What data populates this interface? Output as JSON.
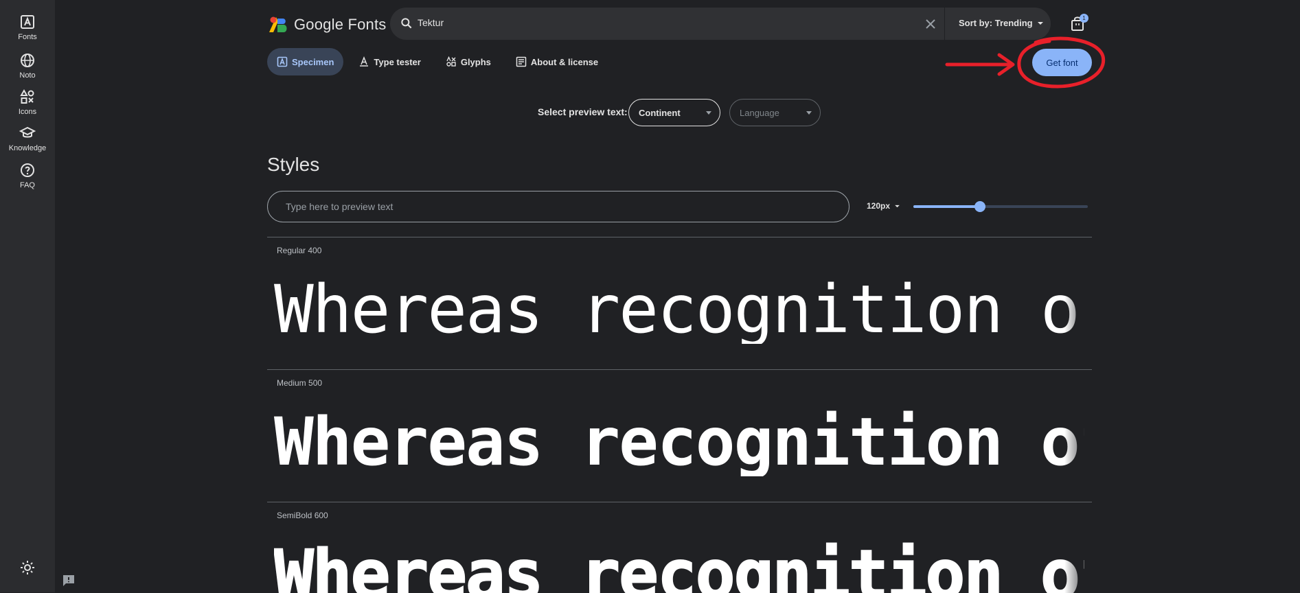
{
  "rail": {
    "items": [
      {
        "label": "Fonts",
        "icon": "fonts-icon"
      },
      {
        "label": "Noto",
        "icon": "globe-icon"
      },
      {
        "label": "Icons",
        "icon": "shapes-icon"
      },
      {
        "label": "Knowledge",
        "icon": "graduation-cap-icon"
      },
      {
        "label": "FAQ",
        "icon": "help-circle-icon"
      }
    ]
  },
  "header": {
    "logo_text": "Google Fonts",
    "search_value": "Tektur",
    "sort_label": "Sort by: Trending",
    "cart_count": "1"
  },
  "tabs": [
    {
      "label": "Specimen",
      "active": true
    },
    {
      "label": "Type tester",
      "active": false
    },
    {
      "label": "Glyphs",
      "active": false
    },
    {
      "label": "About & license",
      "active": false
    }
  ],
  "get_font_label": "Get font",
  "preview": {
    "label": "Select preview text:",
    "selected": "Continent",
    "language_placeholder": "Language"
  },
  "styles": {
    "heading": "Styles",
    "input_placeholder": "Type here to preview text",
    "size_label": "120px",
    "size_fraction": 0.38,
    "rows": [
      {
        "name": "Regular 400",
        "sample": "Whereas recognition of"
      },
      {
        "name": "Medium 500",
        "sample": "Whereas recognition of"
      },
      {
        "name": "SemiBold 600",
        "sample": "Whereas recognition of"
      }
    ]
  },
  "colors": {
    "background": "#202124",
    "accent": "#8ab4f8",
    "annotation": "#e8202a"
  }
}
